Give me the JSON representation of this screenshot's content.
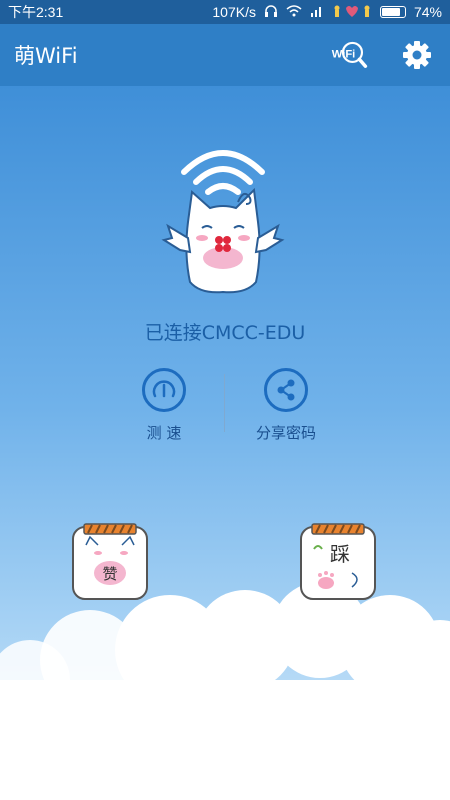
{
  "status_bar": {
    "time": "下午2:31",
    "speed": "107K/s",
    "battery": "74%",
    "battery_fraction": 0.74
  },
  "app_bar": {
    "title": "萌WiFi",
    "search_icon_text": "WiFi",
    "icons": [
      "wifi-search-icon",
      "gear-icon"
    ]
  },
  "main": {
    "connection_status": "已连接CMCC-EDU",
    "actions": [
      {
        "label": "测 速",
        "icon": "speed-gauge-icon"
      },
      {
        "label": "分享密码",
        "icon": "share-icon"
      }
    ],
    "cards": [
      {
        "text": "赞"
      },
      {
        "text": "踩"
      }
    ]
  },
  "colors": {
    "status_bar": "#1f5f9c",
    "app_bar": "#2f7fc6",
    "accent": "#1d6cbf",
    "label": "#1a4f8f"
  }
}
